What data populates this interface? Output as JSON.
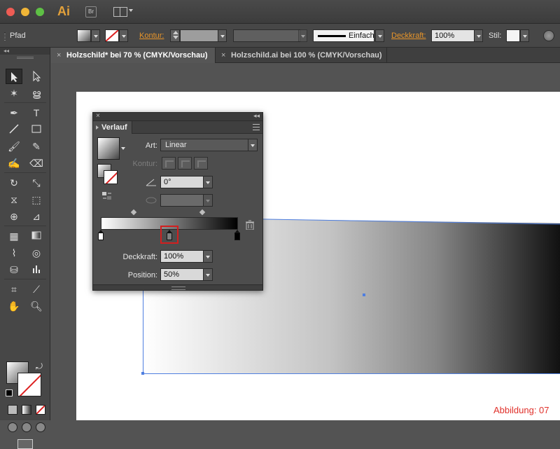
{
  "app": {
    "logo": "Ai",
    "bridge": "Br"
  },
  "controlbar": {
    "object_type": "Pfad",
    "stroke_label": "Kontur:",
    "stroke_style": "Einfach",
    "opacity_label": "Deckkraft:",
    "opacity_value": "100%",
    "style_label": "Stil:"
  },
  "tabs": [
    {
      "label": "Holzschild* bei 70 % (CMYK/Vorschau)",
      "active": true
    },
    {
      "label": "Holzschild.ai bei 100 % (CMYK/Vorschau)",
      "active": false
    }
  ],
  "gradient_panel": {
    "title": "Verlauf",
    "type_label": "Art:",
    "type_value": "Linear",
    "stroke_label": "Kontur:",
    "angle_value": "0°",
    "aspect_value": "",
    "opacity_label": "Deckkraft:",
    "opacity_value": "100%",
    "position_label": "Position:",
    "position_value": "50%",
    "stops": [
      {
        "position": 0,
        "color": "#ffffff"
      },
      {
        "position": 50,
        "color": "#808080"
      },
      {
        "position": 100,
        "color": "#000000"
      }
    ]
  },
  "caption": "Abbildung: 07",
  "colors": {
    "accent_label": "#e8952a",
    "selection": "#4f7fe0",
    "highlight": "#d21f1f"
  }
}
